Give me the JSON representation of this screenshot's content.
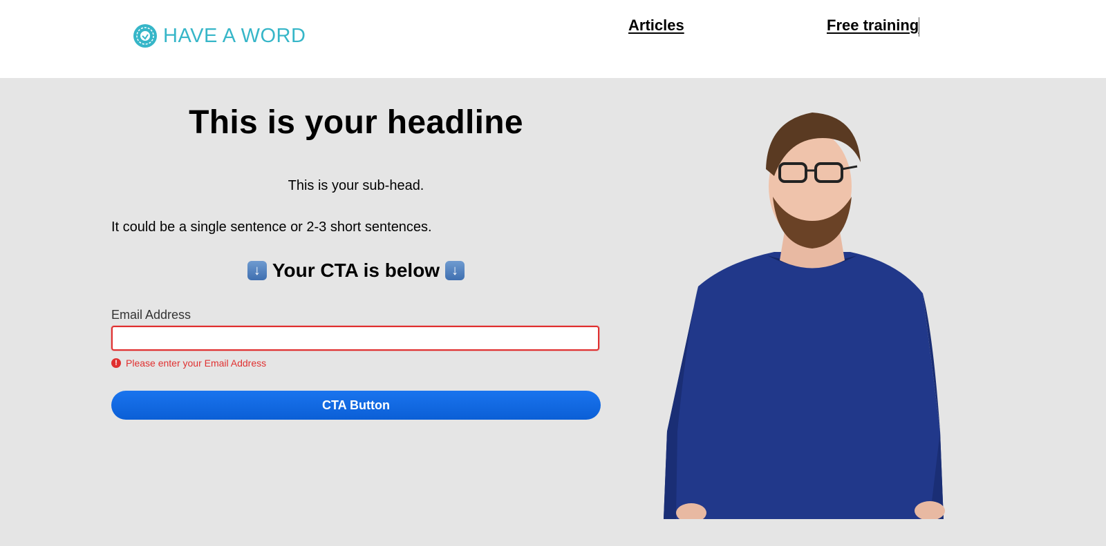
{
  "header": {
    "logo_text": "HAVE A WORD",
    "nav": [
      {
        "label": "Articles"
      },
      {
        "label": "Free training"
      }
    ]
  },
  "hero": {
    "headline": "This is your headline",
    "subhead": "This is your sub-head.",
    "body": "It could be a single sentence or 2-3 short sentences.",
    "cta_heading": "Your CTA is below",
    "arrow_icon": "down-arrow-icon"
  },
  "form": {
    "email_label": "Email Address",
    "email_value": "",
    "error_message": "Please enter your Email Address",
    "button_label": "CTA Button"
  },
  "colors": {
    "brand": "#36b6c8",
    "background": "#e5e5e5",
    "error": "#e03030",
    "button": "#0b5fd6"
  }
}
